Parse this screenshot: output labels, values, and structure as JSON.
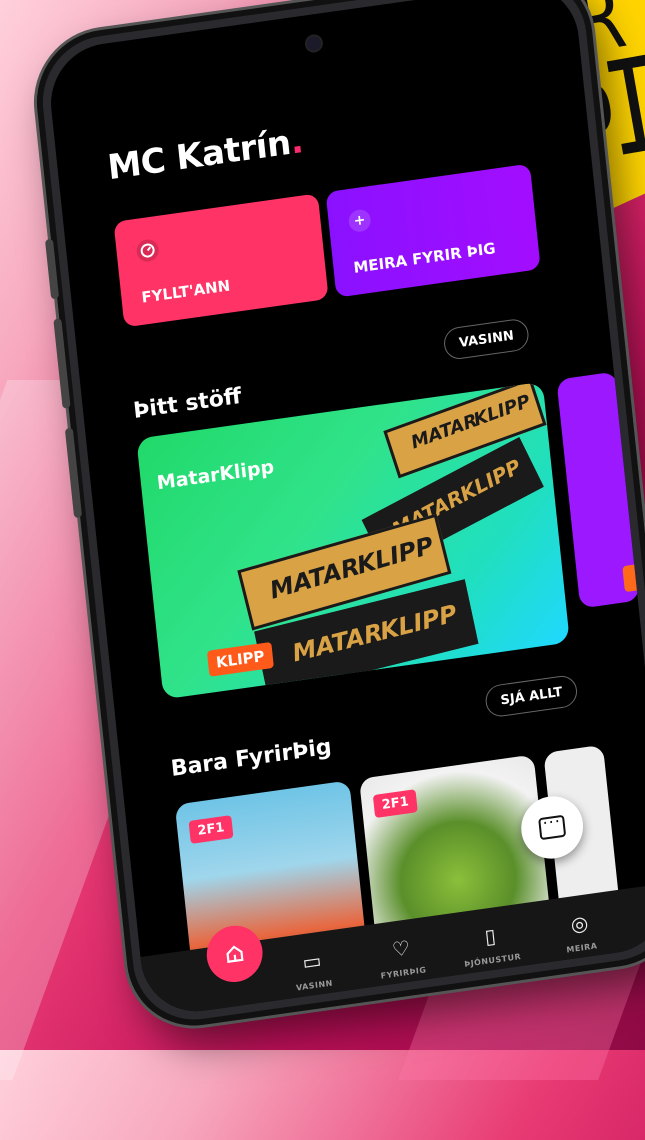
{
  "logo": {
    "line1": "FYRIR",
    "line2": "ÞIG",
    "color": "#ffd400"
  },
  "app": {
    "title": "MC Katrín",
    "title_dot": ".",
    "accent": "#ff3366"
  },
  "quick_actions": {
    "fill": {
      "icon": "gauge-icon",
      "label": "FYLLT'ANN"
    },
    "meira": {
      "icon": "plus-icon",
      "icon_glyph": "+",
      "label": "MEIRA FYRIR ÞIG"
    }
  },
  "stuff": {
    "title": "Þitt stöff",
    "action": "VASINN",
    "card": {
      "name": "MatarKlipp",
      "badge": "KLIPP",
      "ticket_words": [
        "MATAR",
        "KLIPP"
      ]
    }
  },
  "deals": {
    "title": "Bara FyrirÞig",
    "action": "SJÁ ALLT",
    "items": [
      {
        "badge": "2F1"
      },
      {
        "badge": "2F1"
      }
    ]
  },
  "nav": {
    "items": [
      {
        "icon": "home-icon",
        "label": ""
      },
      {
        "icon": "wallet-icon",
        "label": "VASINN"
      },
      {
        "icon": "heart-icon",
        "label": "FYRIRÞIG"
      },
      {
        "icon": "phone-service-icon",
        "label": "ÞJÓNUSTUR"
      },
      {
        "icon": "user-icon",
        "label": "MEIRA"
      }
    ]
  }
}
